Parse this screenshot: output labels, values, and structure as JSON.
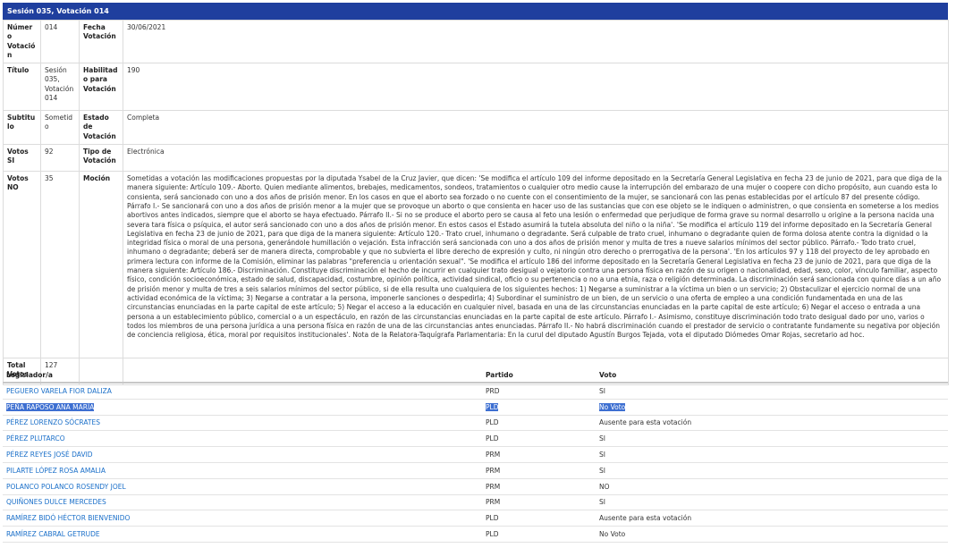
{
  "header": {
    "title": "Sesión 035, Votación 014"
  },
  "details": {
    "numero_label": "Número Votación",
    "numero_value": "014",
    "fecha_label": "Fecha Votación",
    "fecha_value": "30/06/2021",
    "titulo_label": "Título",
    "titulo_value": "Sesión 035, Votación 014",
    "habilitado_label": "Habilitado para Votación",
    "habilitado_value": "190",
    "subtitulo_label": "Subtitulo",
    "subtitulo_value": "Sometido",
    "estado_label": "Estado de Votación",
    "estado_value": "Completa",
    "votos_si_label": "Votos SI",
    "votos_si_value": "92",
    "tipo_label": "Tipo de Votación",
    "tipo_value": "Electrónica",
    "votos_no_label": "Votos NO",
    "votos_no_value": "35",
    "mocion_label": "Moción",
    "mocion_value": "Sometidas a votación las modificaciones propuestas por la diputada Ysabel de la Cruz Javier, que dicen: 'Se modifica el artículo 109 del informe depositado en la Secretaría General Legislativa en fecha 23 de junio de 2021, para que diga de la manera siguiente: Artículo 109.- Aborto. Quien mediante alimentos, brebajes, medicamentos, sondeos, tratamientos o cualquier otro medio cause la interrupción del embarazo de una mujer o coopere con dicho propósito, aun cuando esta lo consienta, será sancionado con uno a dos años de prisión menor. En los casos en que el aborto sea forzado o no cuente con el consentimiento de la mujer, se sancionará con las penas establecidas por el artículo 87 del presente código. Párrafo I.- Se sancionará con uno a dos años de prisión menor a la mujer que se provoque un aborto o que consienta en hacer uso de las sustancias que con ese objeto se le indiquen o administren, o que consienta en someterse a los medios abortivos antes indicados, siempre que el aborto se haya efectuado. Párrafo II.- Si no se produce el aborto pero se causa al feto una lesión o enfermedad que perjudique de forma grave su normal desarrollo u origine a la persona nacida una severa tara física o psíquica, el autor será sancionado con uno a dos años de prisión menor. En estos casos el Estado asumirá la tutela absoluta del niño o la niña'. 'Se modifica el artículo 119 del informe depositado en la Secretaría General Legislativa en fecha 23 de junio de 2021, para que diga de la manera siguiente: Artículo 120.- Trato cruel, inhumano o degradante. Será culpable de trato cruel, inhumano o degradante quien de forma dolosa atente contra la dignidad o la integridad física o moral de una persona, generándole humillación o vejación. Esta infracción será sancionada con uno a dos años de prisión menor y multa de tres a nueve salarios mínimos del sector público. Párrafo.- Todo trato cruel, inhumano o degradante; deberá ser de manera directa, comprobable y que no subvierta el libre derecho de expresión y culto, ni ningún otro derecho o prerrogativa de la persona'. 'En los artículos 97 y 118 del proyecto de ley aprobado en primera lectura con informe de la Comisión, eliminar las palabras \"preferencia u orientación sexual\". 'Se modifica el artículo 186 del informe depositado en la Secretaría General Legislativa en fecha 23 de junio de 2021, para que diga de la manera siguiente: Artículo 186.- Discriminación. Constituye discriminación el hecho de incurrir en cualquier trato desigual o vejatorio contra una persona física en razón de su origen o nacionalidad, edad, sexo, color, vínculo familiar, aspecto físico, condición socioeconómica, estado de salud, discapacidad, costumbre, opinión política, actividad sindical, oficio o su pertenencia o no a una etnia, raza o religión determinada. La discriminación será sancionada con quince días a un año de prisión menor y multa de tres a seis salarios mínimos del sector público, si de ella resulta uno cualquiera de los siguientes hechos: 1) Negarse a suministrar a la víctima un bien o un servicio; 2) Obstaculizar el ejercicio normal de una actividad económica de la víctima; 3) Negarse a contratar a la persona, imponerle sanciones o despedirla; 4) Subordinar el suministro de un bien, de un servicio o una oferta de empleo a una condición fundamentada en una de las circunstancias enunciadas en la parte capital de este artículo; 5) Negar el acceso a la educación en cualquier nivel, basada en una de las circunstancias enunciadas en la parte capital de este artículo; 6) Negar el acceso o entrada a una persona a un establecimiento público, comercial o a un espectáculo, en razón de las circunstancias enunciadas en la parte capital de este artículo. Párrafo I.- Asimismo, constituye discriminación todo trato desigual dado por uno, varios o todos los miembros de una persona jurídica a una persona física en razón de una de las circunstancias antes enunciadas. Párrafo II.- No habrá discriminación cuando el prestador de servicio o contratante fundamente su negativa por objeción de conciencia religiosa, ética, moral por requisitos institucionales'. Nota de la Relatora-Taquígrafa Parlamentaria: En la curul del diputado Agustín Burgos Tejada, vota el diputado Diómedes Omar Rojas, secretario ad hoc.",
    "total_label": "Total Votos",
    "total_value": "127"
  },
  "roster": {
    "headers": {
      "legislador": "Legislador/a",
      "partido": "Partido",
      "voto": "Voto"
    },
    "rows": [
      {
        "name": "PEGUERO VARELA FIOR DALIZA",
        "partido": "PRD",
        "voto": "SI"
      },
      {
        "name": "PEÑA RAPOSO ANA MARÍA",
        "partido": "PLD",
        "voto": "No Voto"
      },
      {
        "name": "PÉREZ LORENZO SÓCRATES",
        "partido": "PLD",
        "voto": "Ausente para esta votación"
      },
      {
        "name": "PÉREZ PLUTARCO",
        "partido": "PLD",
        "voto": "SI"
      },
      {
        "name": "PÉREZ REYES JOSÉ DAVID",
        "partido": "PRM",
        "voto": "SI"
      },
      {
        "name": "PILARTE LÓPEZ ROSA AMALIA",
        "partido": "PRM",
        "voto": "SI"
      },
      {
        "name": "POLANCO POLANCO ROSENDY JOEL",
        "partido": "PRM",
        "voto": "NO"
      },
      {
        "name": "QUIÑONES DULCE MERCEDES",
        "partido": "PRM",
        "voto": "SI"
      },
      {
        "name": "RAMÍREZ BIDÓ HÉCTOR BIENVENIDO",
        "partido": "PLD",
        "voto": "Ausente para esta votación"
      },
      {
        "name": "RAMÍREZ CABRAL GETRUDE",
        "partido": "PLD",
        "voto": "No Voto"
      }
    ]
  }
}
